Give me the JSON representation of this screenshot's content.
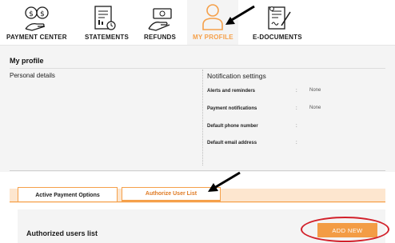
{
  "nav": {
    "items": [
      {
        "label": "PAYMENT CENTER",
        "icon": "dollar-coins-hand-icon"
      },
      {
        "label": "STATEMENTS",
        "icon": "statement-document-icon"
      },
      {
        "label": "REFUNDS",
        "icon": "refund-cash-icon"
      },
      {
        "label": "MY PROFILE",
        "icon": "person-icon",
        "active": true
      },
      {
        "label": "E-DOCUMENTS",
        "icon": "signed-document-icon"
      }
    ]
  },
  "profile": {
    "title": "My profile",
    "personal_details": "Personal details",
    "notifications": {
      "title": "Notification settings",
      "rows": [
        {
          "label": "Alerts and reminders",
          "value": "None"
        },
        {
          "label": "Payment notifications",
          "value": "None"
        },
        {
          "label": "Default phone number",
          "value": ""
        },
        {
          "label": "Default email address",
          "value": ""
        }
      ]
    }
  },
  "tabs": {
    "items": [
      {
        "label": "Active Payment Options",
        "active": false
      },
      {
        "label": "Authorize User List",
        "active": true
      }
    ]
  },
  "users": {
    "title": "Authorized users list",
    "add_label": "ADD NEW"
  },
  "colors": {
    "accent": "#f5a04a",
    "button": "#f39c45",
    "highlight_ring": "#d2202a",
    "panel_bg": "#f4f4f4"
  }
}
